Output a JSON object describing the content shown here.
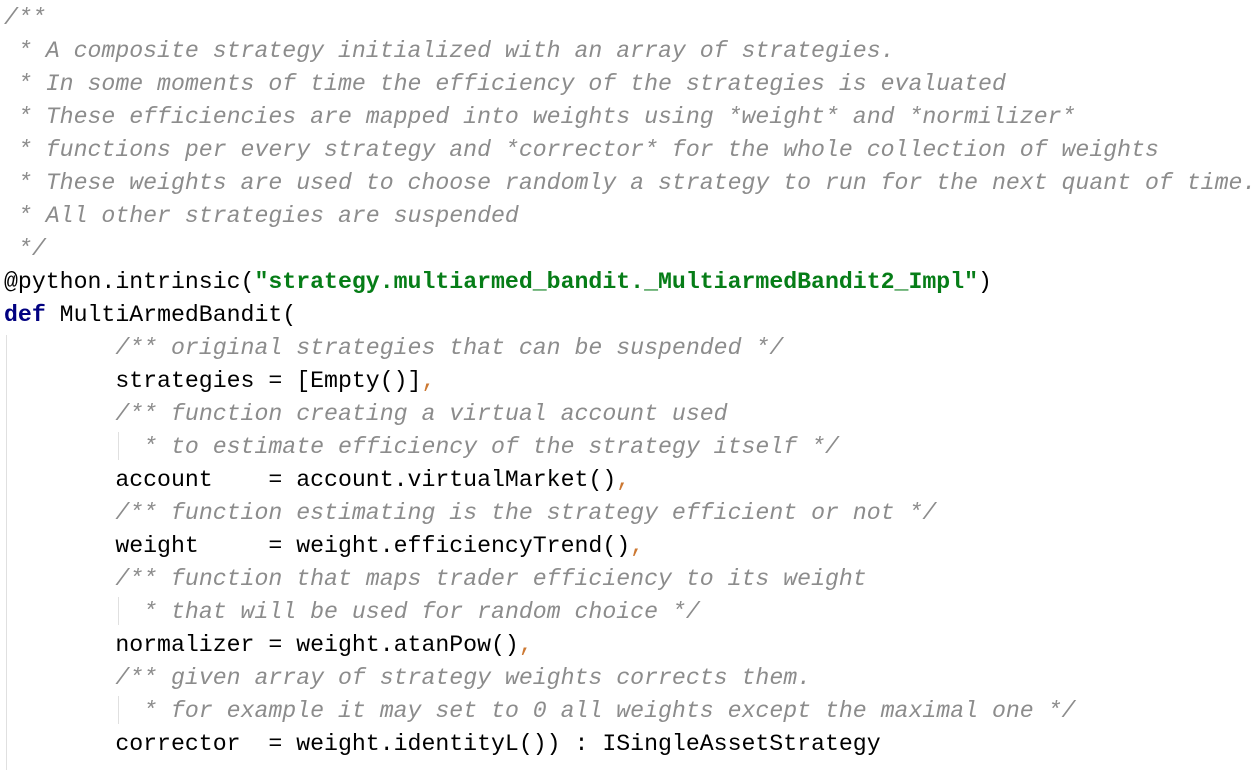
{
  "editor": {
    "colors": {
      "comment": "#8c8c8c",
      "string": "#067d17",
      "keyword": "#000080",
      "comma": "#cc7832"
    },
    "lines": [
      [
        {
          "t": "/**",
          "k": "c"
        }
      ],
      [
        {
          "t": " * A composite strategy initialized with an array of strategies.",
          "k": "c"
        }
      ],
      [
        {
          "t": " * In some moments of time the efficiency of the strategies is evaluated",
          "k": "c"
        }
      ],
      [
        {
          "t": " * These efficiencies are mapped into weights using *weight* and *normilizer*",
          "k": "c"
        }
      ],
      [
        {
          "t": " * functions per every strategy and *corrector* for the whole collection of weights",
          "k": "c"
        }
      ],
      [
        {
          "t": " * These weights are used to choose randomly a strategy to run for the next quant of time.",
          "k": "c"
        }
      ],
      [
        {
          "t": " * All other strategies are suspended",
          "k": "c"
        }
      ],
      [
        {
          "t": " */",
          "k": "c"
        }
      ],
      [
        {
          "t": "@python.intrinsic(",
          "k": ""
        },
        {
          "t": "\"strategy.multiarmed_bandit._MultiarmedBandit2_Impl\"",
          "k": "s"
        },
        {
          "t": ")",
          "k": ""
        }
      ],
      [
        {
          "t": "def",
          "k": "k"
        },
        {
          "t": " MultiArmedBandit(",
          "k": ""
        }
      ],
      [
        {
          "t": "        ",
          "k": ""
        },
        {
          "t": "/** original strategies that can be suspended */",
          "k": "c"
        }
      ],
      [
        {
          "t": "        strategies = [Empty()]",
          "k": ""
        },
        {
          "t": ",",
          "k": "p"
        }
      ],
      [
        {
          "t": "        ",
          "k": ""
        },
        {
          "t": "/** function creating a virtual account used",
          "k": "c"
        }
      ],
      [
        {
          "t": "        ",
          "k": ""
        },
        {
          "t": "  * to estimate efficiency of the strategy itself */",
          "k": "c"
        }
      ],
      [
        {
          "t": "        account    = account.virtualMarket()",
          "k": ""
        },
        {
          "t": ",",
          "k": "p"
        }
      ],
      [
        {
          "t": "        ",
          "k": ""
        },
        {
          "t": "/** function estimating is the strategy efficient or not */",
          "k": "c"
        }
      ],
      [
        {
          "t": "        weight     = weight.efficiencyTrend()",
          "k": ""
        },
        {
          "t": ",",
          "k": "p"
        }
      ],
      [
        {
          "t": "        ",
          "k": ""
        },
        {
          "t": "/** function that maps trader efficiency to its weight",
          "k": "c"
        }
      ],
      [
        {
          "t": "        ",
          "k": ""
        },
        {
          "t": "  * that will be used for random choice */",
          "k": "c"
        }
      ],
      [
        {
          "t": "        normalizer = weight.atanPow()",
          "k": ""
        },
        {
          "t": ",",
          "k": "p"
        }
      ],
      [
        {
          "t": "        ",
          "k": ""
        },
        {
          "t": "/** given array of strategy weights corrects them.",
          "k": "c"
        }
      ],
      [
        {
          "t": "        ",
          "k": ""
        },
        {
          "t": "  * for example it may set to 0 all weights except the maximal one */",
          "k": "c"
        }
      ],
      [
        {
          "t": "        corrector  = weight.identityL()) : ISingleAssetStrategy",
          "k": ""
        }
      ]
    ]
  }
}
